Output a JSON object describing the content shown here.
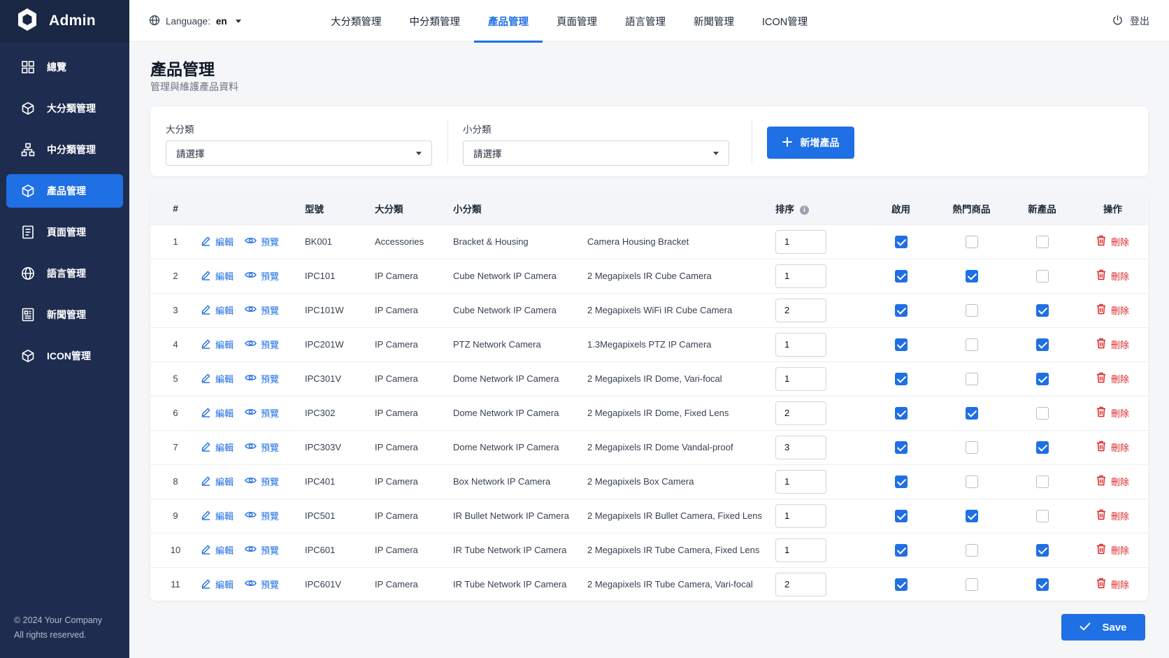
{
  "app": {
    "title": "Admin"
  },
  "sidebar": {
    "items": [
      {
        "label": "總覽",
        "icon": "grid-icon"
      },
      {
        "label": "大分類管理",
        "icon": "cube-icon"
      },
      {
        "label": "中分類管理",
        "icon": "hierarchy-icon"
      },
      {
        "label": "產品管理",
        "icon": "cube-icon",
        "active": true
      },
      {
        "label": "頁面管理",
        "icon": "document-icon"
      },
      {
        "label": "語言管理",
        "icon": "globe-icon"
      },
      {
        "label": "新聞管理",
        "icon": "newspaper-icon"
      },
      {
        "label": "ICON管理",
        "icon": "cube-icon"
      }
    ],
    "copyright": "© 2024 Your Company",
    "rights": "All rights reserved."
  },
  "topbar": {
    "language_label": "Language:",
    "language_value": "en",
    "tabs": [
      {
        "label": "大分類管理"
      },
      {
        "label": "中分類管理"
      },
      {
        "label": "產品管理",
        "active": true
      },
      {
        "label": "頁面管理"
      },
      {
        "label": "語言管理"
      },
      {
        "label": "新聞管理"
      },
      {
        "label": "ICON管理"
      }
    ],
    "logout": "登出"
  },
  "page": {
    "title": "產品管理",
    "subtitle": "管理與維護產品資料"
  },
  "filters": {
    "category_label": "大分類",
    "category_value": "請選擇",
    "subcategory_label": "小分類",
    "subcategory_value": "請選擇",
    "add_button": "新增產品"
  },
  "table": {
    "headers": {
      "num": "#",
      "model": "型號",
      "category": "大分類",
      "subcategory": "小分類",
      "order": "排序",
      "enabled": "啟用",
      "hot": "熱門商品",
      "new": "新產品",
      "actions": "操作"
    },
    "edit_label": "編輯",
    "preview_label": "預覽",
    "delete_label": "刪除",
    "rows": [
      {
        "num": "1",
        "model": "BK001",
        "category": "Accessories",
        "subcategory": "Bracket & Housing",
        "name": "Camera Housing Bracket",
        "order": "1",
        "enabled": true,
        "hot": false,
        "new": false
      },
      {
        "num": "2",
        "model": "IPC101",
        "category": "IP Camera",
        "subcategory": "Cube Network IP Camera",
        "name": "2 Megapixels IR Cube Camera",
        "order": "1",
        "enabled": true,
        "hot": true,
        "new": false
      },
      {
        "num": "3",
        "model": "IPC101W",
        "category": "IP Camera",
        "subcategory": "Cube Network IP Camera",
        "name": "2 Megapixels WiFi IR Cube Camera",
        "order": "2",
        "enabled": true,
        "hot": false,
        "new": true
      },
      {
        "num": "4",
        "model": "IPC201W",
        "category": "IP Camera",
        "subcategory": "PTZ Network Camera",
        "name": "1.3Megapixels PTZ IP Camera",
        "order": "1",
        "enabled": true,
        "hot": false,
        "new": true
      },
      {
        "num": "5",
        "model": "IPC301V",
        "category": "IP Camera",
        "subcategory": "Dome Network IP Camera",
        "name": "2 Megapixels IR Dome, Vari-focal",
        "order": "1",
        "enabled": true,
        "hot": false,
        "new": true
      },
      {
        "num": "6",
        "model": "IPC302",
        "category": "IP Camera",
        "subcategory": "Dome Network IP Camera",
        "name": "2 Megapixels IR Dome, Fixed Lens",
        "order": "2",
        "enabled": true,
        "hot": true,
        "new": false
      },
      {
        "num": "7",
        "model": "IPC303V",
        "category": "IP Camera",
        "subcategory": "Dome Network IP Camera",
        "name": "2 Megapixels IR Dome Vandal-proof",
        "order": "3",
        "enabled": true,
        "hot": false,
        "new": true
      },
      {
        "num": "8",
        "model": "IPC401",
        "category": "IP Camera",
        "subcategory": "Box Network IP Camera",
        "name": "2 Megapixels Box Camera",
        "order": "1",
        "enabled": true,
        "hot": false,
        "new": false
      },
      {
        "num": "9",
        "model": "IPC501",
        "category": "IP Camera",
        "subcategory": "IR Bullet Network IP Camera",
        "name": "2 Megapixels IR Bullet Camera, Fixed Lens",
        "order": "1",
        "enabled": true,
        "hot": true,
        "new": false
      },
      {
        "num": "10",
        "model": "IPC601",
        "category": "IP Camera",
        "subcategory": "IR Tube Network IP Camera",
        "name": "2 Megapixels IR Tube Camera, Fixed Lens",
        "order": "1",
        "enabled": true,
        "hot": false,
        "new": true
      },
      {
        "num": "11",
        "model": "IPC601V",
        "category": "IP Camera",
        "subcategory": "IR Tube Network IP Camera",
        "name": "2 Megapixels IR Tube Camera, Vari-focal",
        "order": "2",
        "enabled": true,
        "hot": false,
        "new": true
      }
    ]
  },
  "save_button": "Save",
  "colors": {
    "primary": "#1f6fe5",
    "sidebar": "#1e2d4f",
    "danger": "#dc2626"
  }
}
